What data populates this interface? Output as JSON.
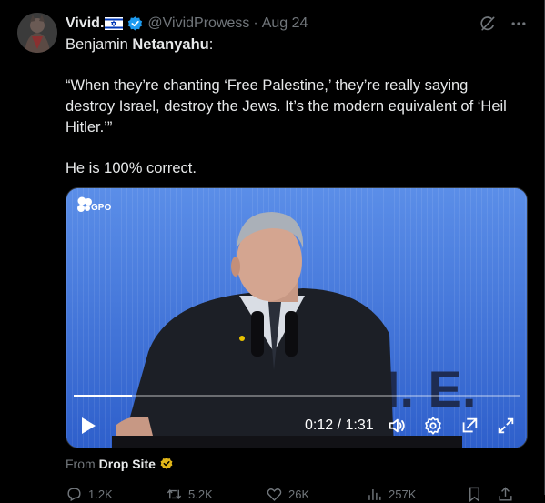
{
  "tweet": {
    "author_name": "Vivid.",
    "handle": "@VividProwess",
    "separator": "·",
    "date": "Aug 24",
    "flag": "israel-flag",
    "verified_color": "#1d9bf0",
    "lines": {
      "l1_pre": "Benjamin ",
      "l1_bold": "Netanyahu",
      "l1_post": ":",
      "quote": "“When they’re chanting ‘Free Palestine,’ they’re really saying destroy Israel, destroy the Jews. It’s the modern equivalent of ‘Heil Hitler.’”",
      "comment": "He is 100% correct."
    }
  },
  "video": {
    "watermark": "GPO",
    "backdrop_text": "H. E.",
    "time": "0:12 / 1:31",
    "progress": 0.13,
    "controls": [
      "play-icon",
      "volume-icon",
      "settings-icon",
      "popout-icon",
      "fullscreen-icon"
    ]
  },
  "source": {
    "from_label": "From",
    "name": "Drop Site",
    "badge_color": "#e2b719"
  },
  "actions": {
    "replies": "1.2K",
    "reposts": "5.2K",
    "likes": "26K",
    "views": "257K"
  },
  "colors": {
    "background": "#000000",
    "text": "#e7e9ea",
    "muted": "#71767b",
    "accent": "#1d9bf0"
  }
}
